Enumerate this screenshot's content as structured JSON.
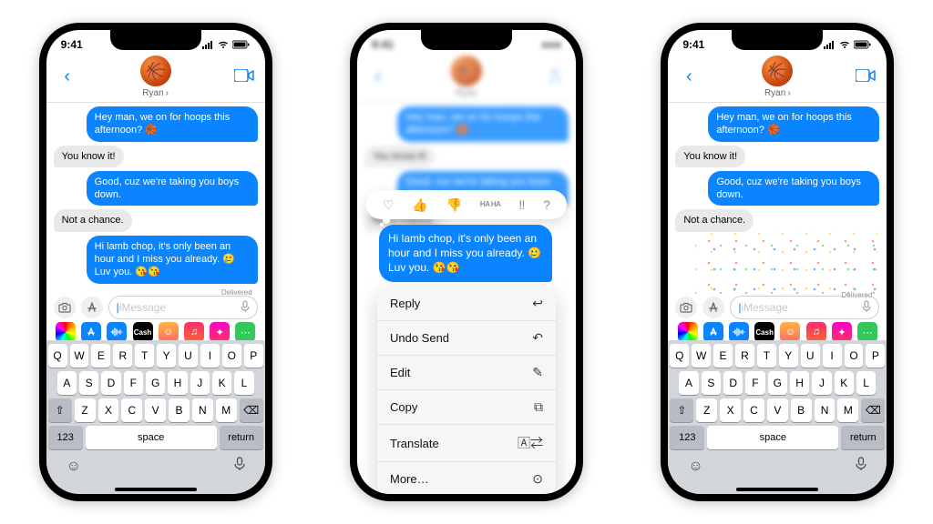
{
  "status": {
    "time": "9:41"
  },
  "contact": {
    "name": "Ryan",
    "avatar_emoji": "🏀"
  },
  "messages": {
    "m0": "Hey man, we on for hoops this afternoon? 🏀",
    "m1": "You know it!",
    "m2": "Good, cuz we're taking you boys down.",
    "m3": "Not a chance.",
    "m4": "Hi lamb chop, it's only been an hour and I miss you already. 🥲 Luv you. 😘😘"
  },
  "delivered_label": "Delivered",
  "compose": {
    "placeholder": "iMessage"
  },
  "tapback": {
    "heart": "♡",
    "up": "👍",
    "down": "👎",
    "haha": "HA HA",
    "bang": "‼",
    "q": "?"
  },
  "context_menu": {
    "reply": "Reply",
    "undo_send": "Undo Send",
    "edit": "Edit",
    "copy": "Copy",
    "translate": "Translate",
    "more": "More…"
  },
  "keyboard": {
    "r1": [
      "Q",
      "W",
      "E",
      "R",
      "T",
      "Y",
      "U",
      "I",
      "O",
      "P"
    ],
    "r2": [
      "A",
      "S",
      "D",
      "F",
      "G",
      "H",
      "J",
      "K",
      "L"
    ],
    "r3": [
      "Z",
      "X",
      "C",
      "V",
      "B",
      "N",
      "M"
    ],
    "numbers": "123",
    "space": "space",
    "return": "return"
  },
  "appstrip": {
    "cash_label": "Cash"
  },
  "colors": {
    "imessage_blue": "#0a84ff"
  }
}
